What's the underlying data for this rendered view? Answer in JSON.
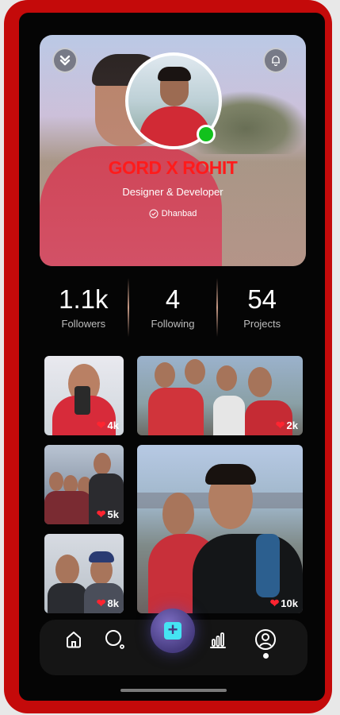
{
  "profile": {
    "name": "GORD X ROHIT",
    "role": "Designer & Developer",
    "location": "Dhanbad"
  },
  "stats": [
    {
      "value": "1.1k",
      "label": "Followers"
    },
    {
      "value": "4",
      "label": "Following"
    },
    {
      "value": "54",
      "label": "Projects"
    }
  ],
  "photos": [
    {
      "likes": "4k"
    },
    {
      "likes": "2k"
    },
    {
      "likes": "5k"
    },
    {
      "likes": "10k"
    },
    {
      "likes": "8k"
    }
  ],
  "nav": {
    "items": [
      "home-icon",
      "search-icon",
      "add-icon",
      "stats-icon",
      "profile-icon"
    ],
    "active": "profile-icon"
  },
  "colors": {
    "frame": "#c40a0a",
    "name": "#ff1b1b",
    "online": "#12c11c",
    "heart": "#ff2430",
    "fab": "#5a4ea0"
  }
}
